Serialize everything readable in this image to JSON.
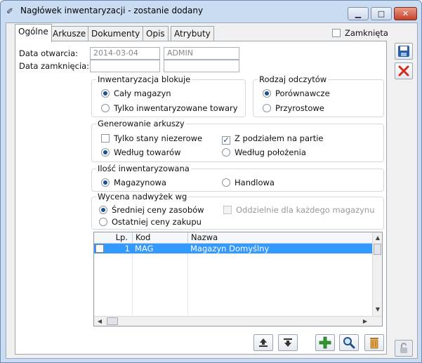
{
  "window": {
    "title": "Nagłówek inwentaryzacji - zostanie dodany",
    "min_glyph": "▁",
    "max_glyph": "□",
    "close_glyph": "✕"
  },
  "tabs": [
    "Ogólne",
    "Arkusze",
    "Dokumenty",
    "Opis",
    "Atrybuty"
  ],
  "closed_checkbox": {
    "label": "Zamknięta",
    "checked": false
  },
  "dates": {
    "open_label": "Data otwarcia:",
    "open_date": "2014-03-04",
    "open_user": "ADMIN",
    "close_label": "Data zamknięcia:",
    "close_date": "",
    "close_user": ""
  },
  "blocks": {
    "title": "Inwentaryzacja blokuje",
    "options": [
      "Cały magazyn",
      "Tylko inwentaryzowane towary"
    ],
    "selected": 0
  },
  "reading_type": {
    "title": "Rodzaj odczytów",
    "options": [
      "Porównawcze",
      "Przyrostowe"
    ],
    "selected": 0
  },
  "sheet_generation": {
    "title": "Generowanie arkuszy",
    "only_nonzero": {
      "label": "Tylko stany niezerowe",
      "checked": false
    },
    "split_by_batch": {
      "label": "Z podziałem na partie",
      "checked": true
    },
    "options": [
      "Według towarów",
      "Według położenia"
    ],
    "selected": 0
  },
  "quantity": {
    "title": "Ilość inwentaryzowana",
    "options": [
      "Magazynowa",
      "Handlowa"
    ],
    "selected": 0
  },
  "valuation": {
    "title": "Wycena nadwyżek wg",
    "options": [
      "Średniej ceny zasobów",
      "Ostatniej ceny zakupu"
    ],
    "selected": 0,
    "per_warehouse": {
      "label": "Oddzielnie dla każdego magazynu",
      "checked": false,
      "disabled": true
    }
  },
  "warehouses": {
    "columns": [
      "Lp.",
      "Kod",
      "Nazwa"
    ],
    "rows": [
      {
        "lp": "1",
        "kod": "MAG",
        "nazwa": "Magazyn Domyślny",
        "checked": false
      }
    ]
  },
  "colors": {
    "selection": "#3399ff",
    "save_accent": "#2a5fa8",
    "cancel_accent": "#d42a1e",
    "add_accent": "#2e9b2e"
  },
  "icons": {
    "save": "save-icon",
    "cancel": "cancel-icon",
    "export": "export-icon",
    "import": "import-icon",
    "add": "plus-icon",
    "search": "magnifier-icon",
    "delete": "trash-icon",
    "lock": "lock-icon"
  }
}
